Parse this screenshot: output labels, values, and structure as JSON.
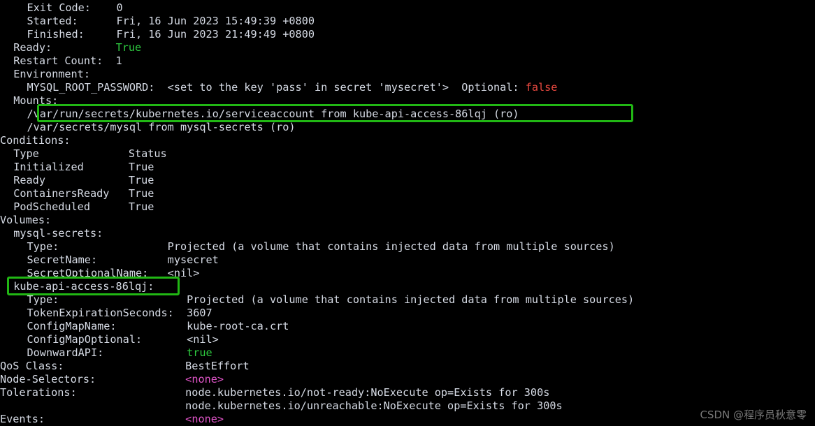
{
  "terminal": {
    "title": "kubectl describe pod output",
    "background_color": "#000000",
    "foreground_color": "#d6dbe5",
    "colors": {
      "green": "#2ecc40",
      "red": "#e8483f",
      "magenta": "#e055c8",
      "highlight_box": "#21b714"
    },
    "lines": [
      {
        "indent": 4,
        "parts": [
          {
            "text": "Exit Code:    0",
            "color": "white"
          }
        ]
      },
      {
        "indent": 4,
        "parts": [
          {
            "text": "Started:      Fri, 16 Jun 2023 15:49:39 +0800",
            "color": "white"
          }
        ]
      },
      {
        "indent": 4,
        "parts": [
          {
            "text": "Finished:     Fri, 16 Jun 2023 21:49:49 +0800",
            "color": "white"
          }
        ]
      },
      {
        "indent": 2,
        "parts": [
          {
            "text": "Ready:          ",
            "color": "white"
          },
          {
            "text": "True",
            "color": "green"
          }
        ]
      },
      {
        "indent": 2,
        "parts": [
          {
            "text": "Restart Count:  1",
            "color": "white"
          }
        ]
      },
      {
        "indent": 2,
        "parts": [
          {
            "text": "Environment:",
            "color": "white"
          }
        ]
      },
      {
        "indent": 4,
        "parts": [
          {
            "text": "MYSQL_ROOT_PASSWORD:  <set to the key 'pass' in secret 'mysecret'>  Optional: ",
            "color": "white"
          },
          {
            "text": "false",
            "color": "red"
          }
        ]
      },
      {
        "indent": 2,
        "parts": [
          {
            "text": "Mounts:",
            "color": "white"
          }
        ]
      },
      {
        "indent": 4,
        "parts": [
          {
            "text": "/var/run/secrets/kubernetes.io/serviceaccount from kube-api-access-86lqj (ro)",
            "color": "white"
          }
        ]
      },
      {
        "indent": 4,
        "parts": [
          {
            "text": "/var/secrets/mysql from mysql-secrets (ro)",
            "color": "white"
          }
        ]
      },
      {
        "indent": 0,
        "parts": [
          {
            "text": "Conditions:",
            "color": "white"
          }
        ]
      },
      {
        "indent": 2,
        "parts": [
          {
            "text": "Type              Status",
            "color": "white"
          }
        ]
      },
      {
        "indent": 2,
        "parts": [
          {
            "text": "Initialized       True",
            "color": "white"
          }
        ]
      },
      {
        "indent": 2,
        "parts": [
          {
            "text": "Ready             True",
            "color": "white"
          }
        ]
      },
      {
        "indent": 2,
        "parts": [
          {
            "text": "ContainersReady   True",
            "color": "white"
          }
        ]
      },
      {
        "indent": 2,
        "parts": [
          {
            "text": "PodScheduled      True",
            "color": "white"
          }
        ]
      },
      {
        "indent": 0,
        "parts": [
          {
            "text": "Volumes:",
            "color": "white"
          }
        ]
      },
      {
        "indent": 2,
        "parts": [
          {
            "text": "mysql-secrets:",
            "color": "white"
          }
        ]
      },
      {
        "indent": 4,
        "parts": [
          {
            "text": "Type:                 Projected (a volume that contains injected data from multiple sources)",
            "color": "white"
          }
        ]
      },
      {
        "indent": 4,
        "parts": [
          {
            "text": "SecretName:           mysecret",
            "color": "white"
          }
        ]
      },
      {
        "indent": 4,
        "parts": [
          {
            "text": "SecretOptionalName:   <nil>",
            "color": "white"
          }
        ]
      },
      {
        "indent": 2,
        "parts": [
          {
            "text": "kube-api-access-86lqj:",
            "color": "white"
          }
        ]
      },
      {
        "indent": 4,
        "parts": [
          {
            "text": "Type:                    Projected (a volume that contains injected data from multiple sources)",
            "color": "white"
          }
        ]
      },
      {
        "indent": 4,
        "parts": [
          {
            "text": "TokenExpirationSeconds:  3607",
            "color": "white"
          }
        ]
      },
      {
        "indent": 4,
        "parts": [
          {
            "text": "ConfigMapName:           kube-root-ca.crt",
            "color": "white"
          }
        ]
      },
      {
        "indent": 4,
        "parts": [
          {
            "text": "ConfigMapOptional:       <nil>",
            "color": "white"
          }
        ]
      },
      {
        "indent": 4,
        "parts": [
          {
            "text": "DownwardAPI:             ",
            "color": "white"
          },
          {
            "text": "true",
            "color": "green"
          }
        ]
      },
      {
        "indent": 0,
        "parts": [
          {
            "text": "QoS Class:                   BestEffort",
            "color": "white"
          }
        ]
      },
      {
        "indent": 0,
        "parts": [
          {
            "text": "Node-Selectors:              ",
            "color": "white"
          },
          {
            "text": "<none>",
            "color": "magenta"
          }
        ]
      },
      {
        "indent": 0,
        "parts": [
          {
            "text": "Tolerations:                 node.kubernetes.io/not-ready:NoExecute op=Exists for 300s",
            "color": "white"
          }
        ]
      },
      {
        "indent": 0,
        "parts": [
          {
            "text": "                             node.kubernetes.io/unreachable:NoExecute op=Exists for 300s",
            "color": "white"
          }
        ]
      },
      {
        "indent": 0,
        "parts": [
          {
            "text": "Events:                      ",
            "color": "white"
          },
          {
            "text": "<none>",
            "color": "magenta"
          }
        ]
      }
    ],
    "highlights": [
      {
        "name": "mounts-serviceaccount-highlight",
        "label": "/var/run/secrets/kubernetes.io/serviceaccount from kube-api-access-86lqj (ro)"
      },
      {
        "name": "volume-kube-api-access-highlight",
        "label": "kube-api-access-86lqj:"
      }
    ],
    "watermark": "CSDN @程序员秋意零"
  }
}
